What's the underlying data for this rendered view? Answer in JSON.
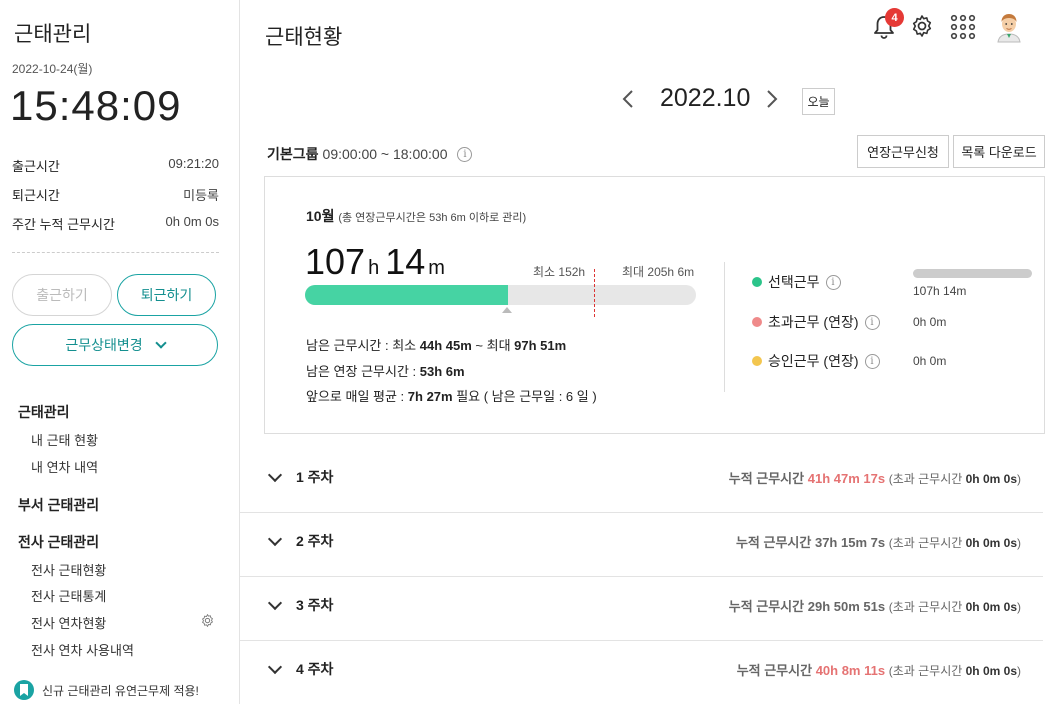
{
  "sidebar": {
    "title": "근태관리",
    "date": "2022-10-24(월)",
    "clock": "15:48:09",
    "rows": [
      {
        "label": "출근시간",
        "value": "09:21:20"
      },
      {
        "label": "퇴근시간",
        "value": "미등록"
      },
      {
        "label": "주간 누적 근무시간",
        "value": "0h 0m 0s"
      }
    ],
    "check_in_label": "출근하기",
    "check_out_label": "퇴근하기",
    "status_change_label": "근무상태변경",
    "nav": {
      "section1": "근태관리",
      "item_my_status": "내 근태 현황",
      "item_my_leave": "내 연차 내역",
      "section2": "부서 근태관리",
      "section3": "전사 근태관리",
      "item_company_status": "전사 근태현황",
      "item_company_stats": "전사 근태통계",
      "item_company_leave": "전사 연차현황",
      "item_company_leave_usage": "전사 연차 사용내역"
    },
    "notice": "신규 근태관리 유연근무제 적용!"
  },
  "header": {
    "title": "근태현황",
    "notification_count": "4"
  },
  "month_nav": {
    "label": "2022.10",
    "today_label": "오늘"
  },
  "group": {
    "name": "기본그룹",
    "hours": "09:00:00 ~ 18:00:00",
    "extend_request_label": "연장근무신청",
    "download_label": "목록 다운로드"
  },
  "summary": {
    "month": "10월",
    "note": "(총 연장근무시간은 53h 6m 이하로 관리)",
    "total_hours": "107",
    "hours_unit": "h",
    "total_minutes": "14",
    "minutes_unit": "m",
    "min_label": "최소 152h",
    "max_label": "최대 205h 6m",
    "progress_fraction": 0.52,
    "remain_prefix": "남은 근무시간 : 최소 ",
    "remain_min": "44h 45m",
    "remain_mid": " ~ 최대 ",
    "remain_max": "97h 51m",
    "remain_ext_prefix": "남은 연장 근무시간 : ",
    "remain_ext": "53h 6m",
    "avg_prefix": "앞으로 매일 평균 : ",
    "avg_value": "7h 27m",
    "avg_suffix": " 필요 ( 남은 근무일 : 6 일 )",
    "legend": [
      {
        "label": "선택근무",
        "value": "107h 14m",
        "color": "#2bc48a"
      },
      {
        "label": "초과근무 (연장)",
        "value": "0h 0m",
        "color": "#ef8a8a"
      },
      {
        "label": "승인근무 (연장)",
        "value": "0h 0m",
        "color": "#f3c64f"
      }
    ]
  },
  "weeks": [
    {
      "label": "1 주차",
      "prefix": "누적 근무시간",
      "time": "41h 47m 17s",
      "over_prefix": "(초과 근무시간",
      "over_value": "0h 0m 0s",
      "over_suffix": ")",
      "highlight": true
    },
    {
      "label": "2 주차",
      "prefix": "누적 근무시간",
      "time": "37h 15m 7s",
      "over_prefix": "(초과 근무시간",
      "over_value": "0h 0m 0s",
      "over_suffix": ")",
      "highlight": false
    },
    {
      "label": "3 주차",
      "prefix": "누적 근무시간",
      "time": "29h 50m 51s",
      "over_prefix": "(초과 근무시간",
      "over_value": "0h 0m 0s",
      "over_suffix": ")",
      "highlight": false
    },
    {
      "label": "4 주차",
      "prefix": "누적 근무시간",
      "time": "40h 8m 11s",
      "over_prefix": "(초과 근무시간",
      "over_value": "0h 0m 0s",
      "over_suffix": ")",
      "highlight": true
    }
  ]
}
